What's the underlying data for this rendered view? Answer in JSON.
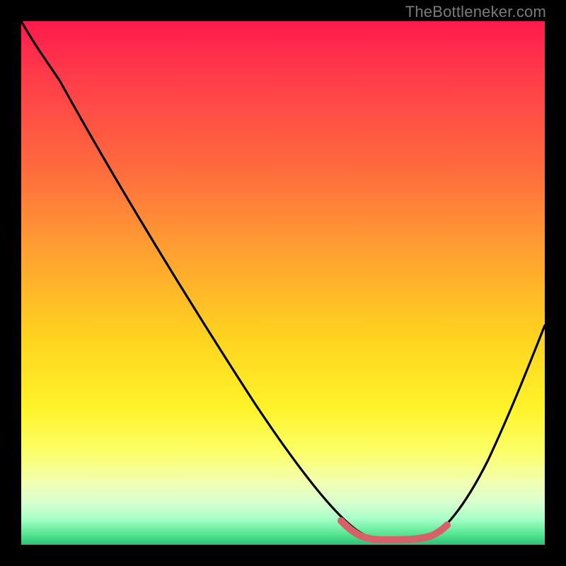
{
  "watermark": "TheBottleneker.com",
  "chart_data": {
    "type": "line",
    "title": "",
    "xlabel": "",
    "ylabel": "",
    "xlim": [
      0,
      100
    ],
    "ylim": [
      0,
      100
    ],
    "x": [
      0,
      4,
      10,
      20,
      30,
      40,
      50,
      58,
      62,
      66,
      70,
      74,
      78,
      82,
      90,
      100
    ],
    "values": [
      100,
      96,
      88,
      75,
      62,
      49,
      35,
      22,
      12,
      4,
      1,
      1,
      1,
      3,
      18,
      42
    ],
    "highlight_segment": {
      "x": [
        62,
        66,
        70,
        74,
        78,
        80
      ],
      "values": [
        5,
        2,
        1,
        1,
        1,
        2
      ]
    },
    "highlight_color": "#d9606b",
    "curve_color": "#000000",
    "background_gradient": [
      "#ff1a4d",
      "#ffd21f",
      "#2fbf72"
    ]
  }
}
